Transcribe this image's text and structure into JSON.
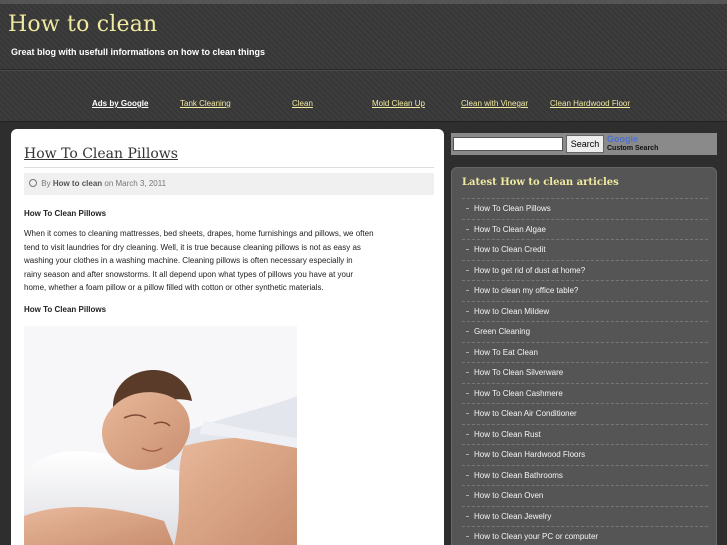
{
  "site": {
    "title": "How to clean",
    "tagline": "Great blog with usefull informations on how to clean things"
  },
  "ads": {
    "label": "Ads by Google",
    "links": [
      "Tank Cleaning",
      "Clean",
      "Mold Clean Up",
      "Clean with Vinegar",
      "Clean Hardwood Floor"
    ]
  },
  "post": {
    "title": "How To Clean Pillows",
    "meta_by": "By",
    "author": "How to clean",
    "meta_on": "on March 3, 2011",
    "heading1": "How To Clean Pillows",
    "paragraph_lines": [
      "When it comes to cleaning mattresses, bed sheets, drapes, home furnishings and pillows, we often",
      "tend to visit laundries for dry cleaning. Well, it is true because cleaning pillows is not as easy as",
      "washing your clothes in a washing machine. Cleaning pillows is often necessary especially in",
      "rainy season and after snowstorms. It all depend upon what types of pillows you have at your",
      "home, whether a foam pillow or a pillow filled with cotton or other synthetic materials."
    ],
    "heading2": "How To Clean Pillows"
  },
  "search": {
    "button_label": "Search",
    "logo_text": "Google",
    "custom_label": "Custom Search"
  },
  "sidebar": {
    "title": "Latest How to clean articles",
    "items": [
      "How To Clean Pillows",
      "How To Clean Algae",
      "How to Clean Credit",
      "How to get rid of dust at home?",
      "How to clean my office table?",
      "How to Clean Mildew",
      "Green Cleaning",
      "How To Eat Clean",
      "How To Clean Silverware",
      "How To Clean Cashmere",
      "How to Clean Air Conditioner",
      "How to Clean Rust",
      "How to Clean Hardwood Floors",
      "How to Clean Bathrooms",
      "How to Clean Oven",
      "How to Clean Jewelry",
      "How to Clean your PC or computer"
    ]
  },
  "colors": {
    "accent_yellow": "#f0eaa0",
    "background_dark": "#3a3a3a",
    "sidebar_bg": "#555555",
    "content_bg": "#ffffff"
  }
}
